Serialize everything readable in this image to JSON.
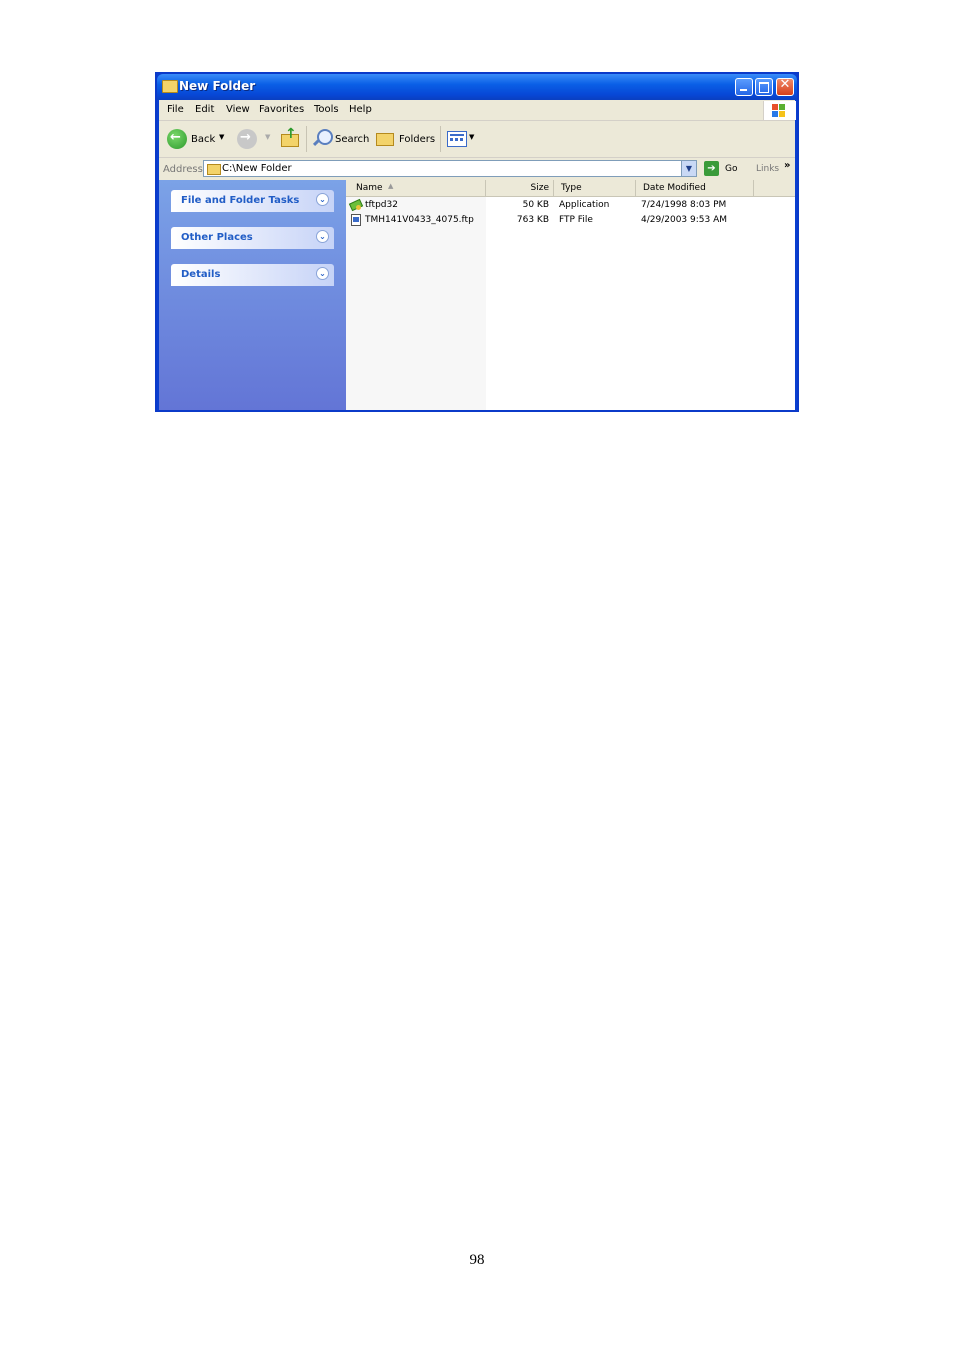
{
  "window": {
    "title": "New Folder"
  },
  "menu": [
    "File",
    "Edit",
    "View",
    "Favorites",
    "Tools",
    "Help"
  ],
  "toolbar": {
    "back_label": "Back",
    "search_label": "Search",
    "folders_label": "Folders"
  },
  "address": {
    "label": "Address",
    "value": "C:\\New Folder",
    "go_label": "Go",
    "links_label": "Links"
  },
  "tasks": {
    "file_folder_tasks": "File and Folder Tasks",
    "other_places": "Other Places",
    "details": "Details"
  },
  "columns": {
    "name": "Name",
    "size": "Size",
    "type": "Type",
    "date": "Date Modified"
  },
  "files": [
    {
      "name": "tftpd32",
      "size": "50 KB",
      "type": "Application",
      "date": "7/24/1998 8:03 PM",
      "icon": "application-icon"
    },
    {
      "name": "TMH141V0433_4075.ftp",
      "size": "763 KB",
      "type": "FTP File",
      "date": "4/29/2003 9:53 AM",
      "icon": "ftp-file-icon"
    }
  ],
  "page_number": "98"
}
